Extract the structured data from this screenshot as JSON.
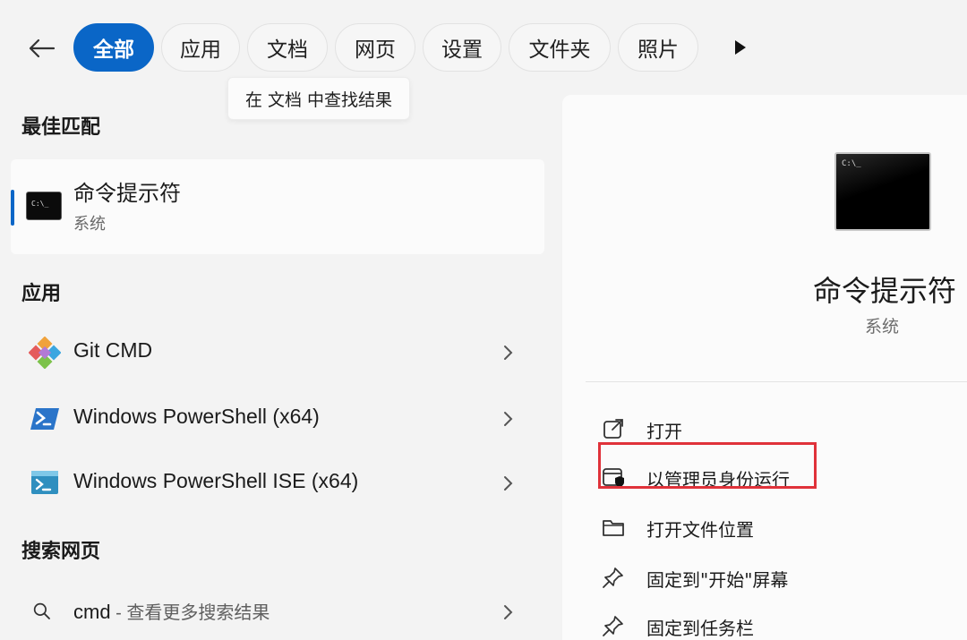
{
  "filters": {
    "items": [
      {
        "label": "全部",
        "active": true
      },
      {
        "label": "应用",
        "active": false
      },
      {
        "label": "文档",
        "active": false
      },
      {
        "label": "网页",
        "active": false
      },
      {
        "label": "设置",
        "active": false
      },
      {
        "label": "文件夹",
        "active": false
      },
      {
        "label": "照片",
        "active": false
      }
    ],
    "tooltip": "在 文档 中查找结果"
  },
  "best_match": {
    "heading": "最佳匹配",
    "title": "命令提示符",
    "subtitle": "系统",
    "icon_text": "C:\\_"
  },
  "apps": {
    "heading": "应用",
    "items": [
      {
        "label": "Git CMD",
        "icon": "git-icon"
      },
      {
        "label": "Windows PowerShell (x64)",
        "icon": "powershell-icon"
      },
      {
        "label": "Windows PowerShell ISE (x64)",
        "icon": "powershell-ise-icon"
      }
    ]
  },
  "web": {
    "heading": "搜索网页",
    "query": "cmd",
    "suffix": " - 查看更多搜索结果"
  },
  "detail": {
    "title": "命令提示符",
    "subtitle": "系统",
    "icon_text": "C:\\_",
    "actions": [
      {
        "label": "打开",
        "icon": "open-external-icon"
      },
      {
        "label": "以管理员身份运行",
        "icon": "admin-shield-icon",
        "highlighted": true
      },
      {
        "label": "打开文件位置",
        "icon": "folder-icon"
      },
      {
        "label": "固定到\"开始\"屏幕",
        "icon": "pin-icon"
      },
      {
        "label": "固定到任务栏",
        "icon": "pin-icon"
      }
    ]
  },
  "colors": {
    "accent": "#0a66c7",
    "highlight": "#e0323a",
    "background": "#f3f3f3"
  }
}
